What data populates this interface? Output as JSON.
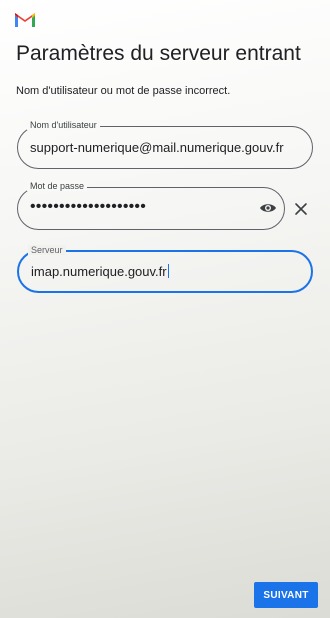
{
  "app": {
    "logo": "gmail-logo"
  },
  "page": {
    "title": "Paramètres du serveur entrant",
    "error_message": "Nom d'utilisateur ou mot de passe incorrect."
  },
  "username": {
    "label": "Nom d'utilisateur",
    "value": "support-numerique@mail.numerique.gouv.fr"
  },
  "password": {
    "label": "Mot de passe",
    "masked_value": "••••••••••••••••••••",
    "show_icon": "eye-icon",
    "clear_icon": "close-icon"
  },
  "server": {
    "label": "Serveur",
    "value": "imap.numerique.gouv.fr"
  },
  "footer": {
    "next_label": "SUIVANT"
  },
  "colors": {
    "accent": "#1a73e8",
    "text": "#202124"
  }
}
